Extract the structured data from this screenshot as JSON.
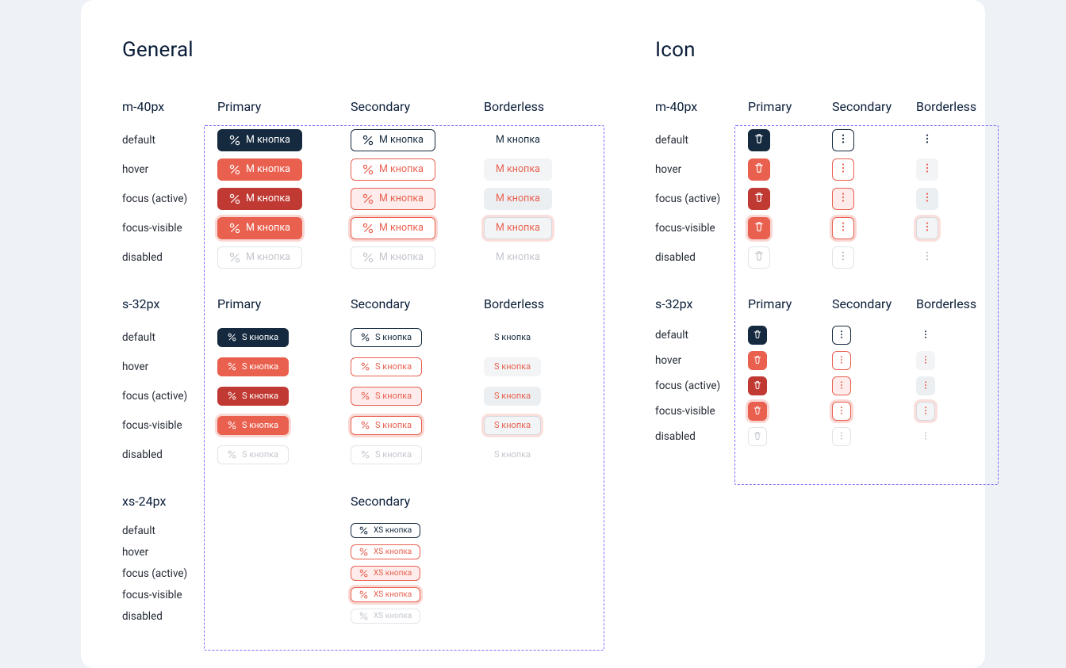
{
  "sections": {
    "general": "General",
    "icon": "Icon"
  },
  "sizes": {
    "m": "m-40px",
    "s": "s-32px",
    "xs": "xs-24px"
  },
  "variants": {
    "primary": "Primary",
    "secondary": "Secondary",
    "borderless": "Borderless"
  },
  "states": {
    "default": "default",
    "hover": "hover",
    "focus_active": "focus (active)",
    "focus_visible": "focus-visible",
    "disabled": "disabled"
  },
  "labels": {
    "m": "М кнопка",
    "s": "S кнопка",
    "xs": "XS кнопка"
  },
  "icons": {
    "percent": "percent-icon",
    "trash": "trash-icon",
    "dots": "dots-vertical-icon"
  },
  "colors": {
    "ink": "#152a3f",
    "accent": "#e9604f",
    "accent_dark": "#c03a33",
    "disabled_text": "#c2c6cc",
    "dash": "#7c6cff"
  }
}
